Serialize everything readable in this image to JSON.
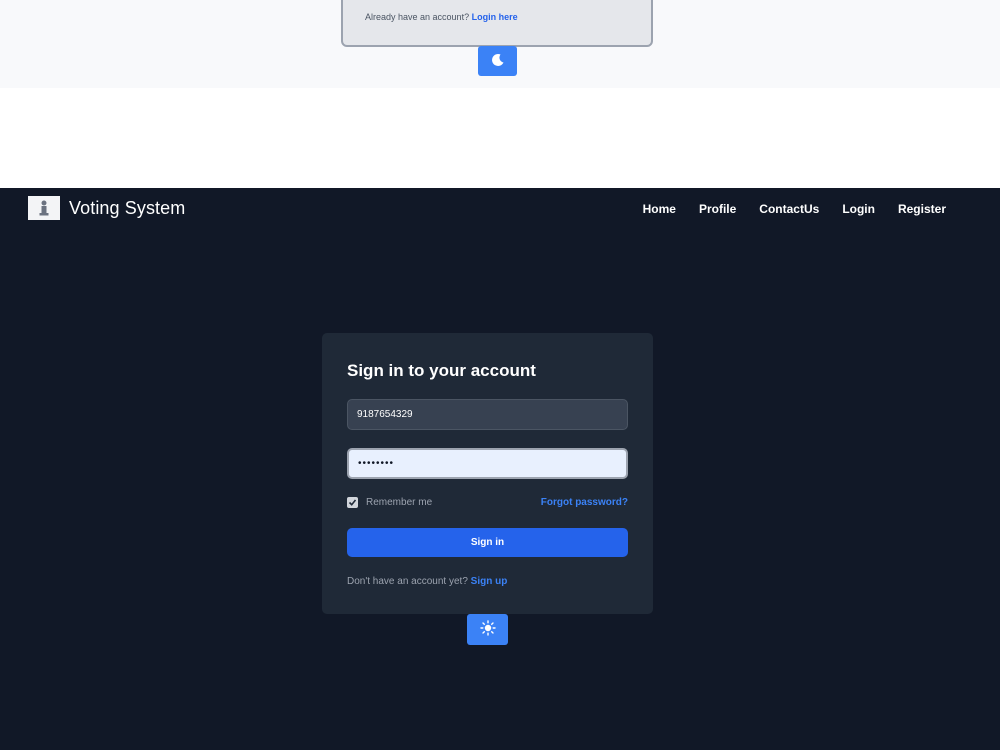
{
  "light_view": {
    "footer_text": "Already have an account?",
    "footer_link": "Login here",
    "theme_toggle_icon": "moon-icon"
  },
  "navbar": {
    "brand": "Voting System",
    "logo_icon": "emblem-icon",
    "links": [
      "Home",
      "Profile",
      "ContactUs",
      "Login",
      "Register"
    ]
  },
  "signin_card": {
    "title": "Sign in to your account",
    "phone_value": "9187654329",
    "password_value": "••••••••",
    "remember_label": "Remember me",
    "remember_checked": true,
    "forgot_link": "Forgot password?",
    "submit_label": "Sign in",
    "signup_text": "Don't have an account yet?",
    "signup_link": "Sign up"
  },
  "theme_toggle_icon": "sun-icon",
  "colors": {
    "dark_bg": "#111827",
    "card_bg": "#1f2937",
    "accent": "#2563eb",
    "link": "#3b82f6"
  }
}
